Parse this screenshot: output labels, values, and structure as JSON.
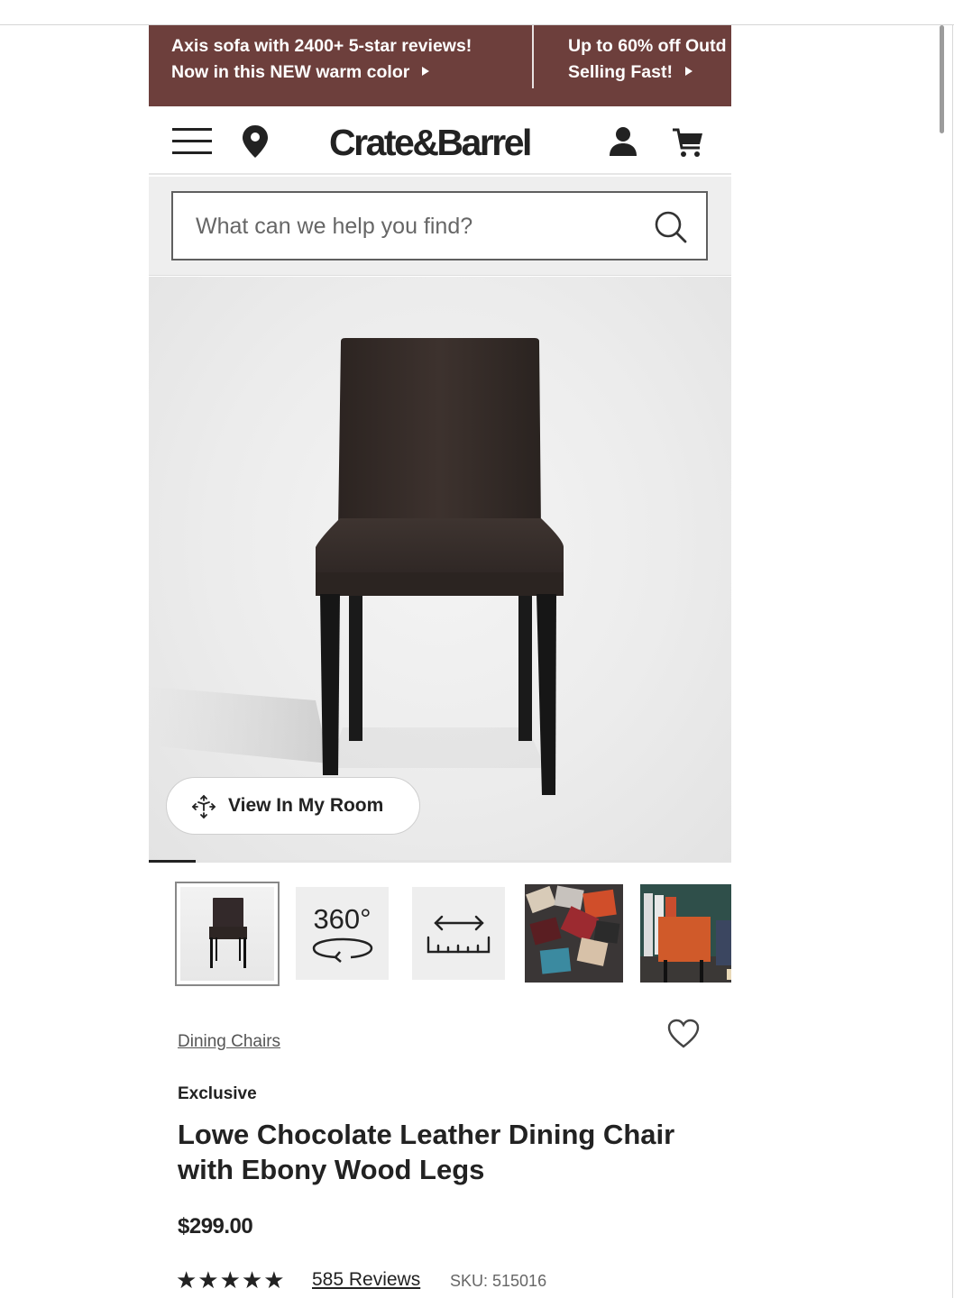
{
  "promo": {
    "items": [
      {
        "line1": "Axis sofa with 2400+ 5-star reviews!",
        "line2": "Now in this NEW warm color"
      },
      {
        "line1": "Up to 60% off Outd",
        "line2": "Selling Fast!"
      }
    ]
  },
  "header": {
    "logo": "Crate&Barrel",
    "icons": [
      "menu-icon",
      "location-pin-icon",
      "account-icon",
      "cart-icon"
    ]
  },
  "search": {
    "placeholder": "What can we help you find?"
  },
  "hero": {
    "view_in_room_label": "View In My Room",
    "gallery_progress": 0.08
  },
  "thumbnails": {
    "spin_label": "360°",
    "icons": [
      "chair-thumbnail",
      "360-view-icon",
      "dimensions-icon",
      "lifestyle-photo",
      "lifestyle-photo"
    ]
  },
  "product": {
    "breadcrumb": "Dining Chairs",
    "badge": "Exclusive",
    "title": "Lowe Chocolate Leather Dining Chair with Ebony Wood Legs",
    "price": "$299.00",
    "rating": 4.5,
    "stars_display": "★★★★★",
    "reviews_label": "585 Reviews",
    "sku": "SKU: 515016"
  },
  "colors": {
    "promo_bg": "#6d3f3c",
    "text": "#222222",
    "chair_leather": "#3a302c",
    "legs": "#1c1c1c"
  }
}
